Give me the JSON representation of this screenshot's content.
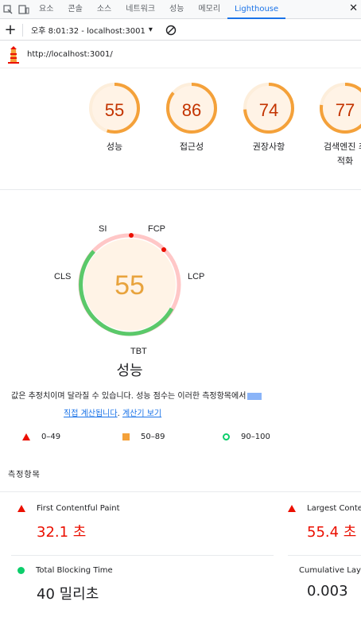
{
  "tabs": [
    "요소",
    "콘솔",
    "소스",
    "네트워크",
    "성능",
    "메모리",
    "Lighthouse"
  ],
  "active_tab": "Lighthouse",
  "toolbar": {
    "add_label": "+",
    "report_label": "오후 8:01:32 - localhost:3001"
  },
  "url": "http://localhost:3001/",
  "gauges": [
    {
      "score": "55",
      "label": "성능",
      "fraction": 0.55
    },
    {
      "score": "86",
      "label": "접근성",
      "fraction": 0.86
    },
    {
      "score": "74",
      "label": "권장사항",
      "fraction": 0.74
    },
    {
      "score": "77",
      "label": "검색엔진 최적화",
      "fraction": 0.77
    }
  ],
  "perf": {
    "score": "55",
    "title": "성능",
    "metric_labels": {
      "si": "SI",
      "fcp": "FCP",
      "lcp": "LCP",
      "tbt": "TBT",
      "cls": "CLS"
    }
  },
  "description": {
    "text": "값은 추정치이며 달라질 수 있습니다. 성능 점수는 이러한 측정항목에서",
    "link1": "직접 계산됩니다",
    "separator": ". ",
    "link2": "계산기 보기"
  },
  "legend": [
    "0–49",
    "50–89",
    "90–100"
  ],
  "metrics_title": "측정항목",
  "metrics": [
    {
      "name": "First Contentful Paint",
      "value": "32.1 초",
      "status": "bad"
    },
    {
      "name": "Largest Contentful Paint",
      "value": "55.4 초",
      "status": "bad"
    },
    {
      "name": "Total Blocking Time",
      "value": "40 밀리초",
      "status": "good"
    },
    {
      "name": "Cumulative Layout Shift",
      "value": "0.003",
      "status": "good"
    }
  ],
  "colors": {
    "accent": "#1a73e8",
    "average": "#f4a13a",
    "fail": "#eb0f00",
    "pass": "#0cce6b"
  },
  "icons": [
    "inspect-icon",
    "device-toggle-icon",
    "close-icon",
    "add-icon",
    "dropdown-icon",
    "block-icon",
    "lighthouse-logo-icon"
  ]
}
